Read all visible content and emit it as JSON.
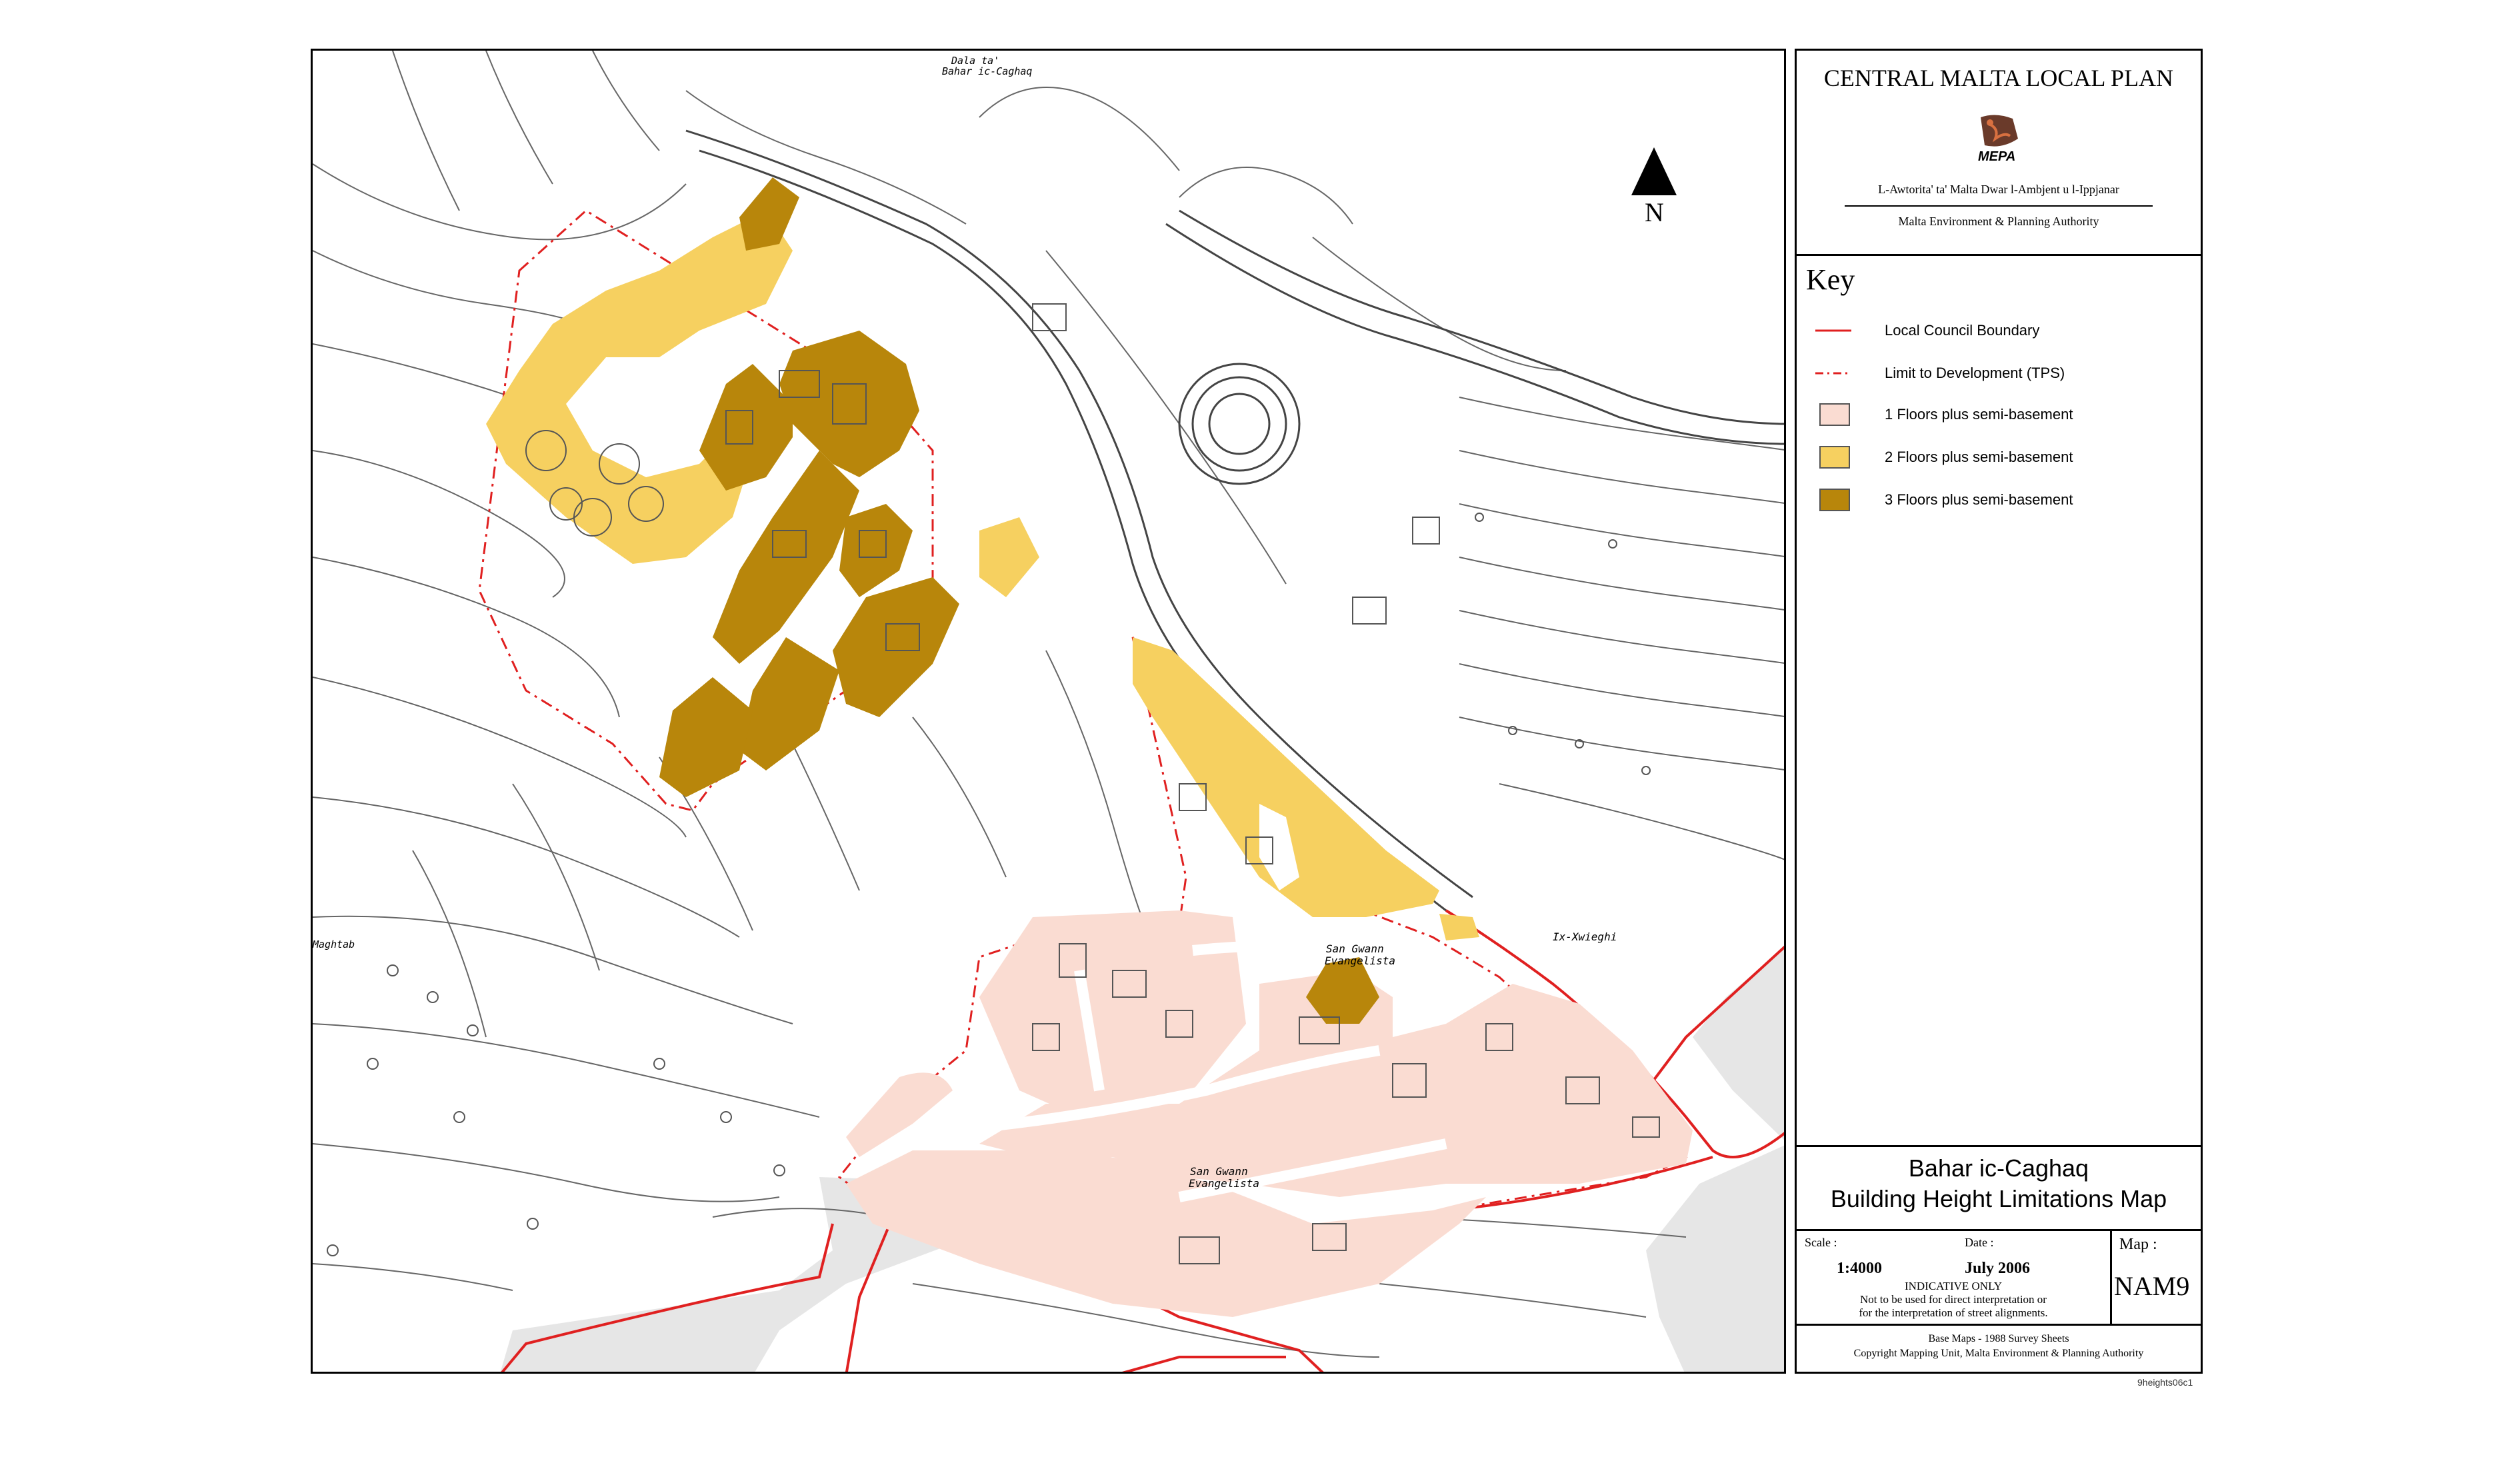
{
  "header": {
    "plan_title": "CENTRAL MALTA LOCAL PLAN",
    "logo_text": "MEPA",
    "authority_maltese": "L-Awtorita' ta' Malta Dwar l-Ambjent u l-Ippjanar",
    "authority_english": "Malta Environment & Planning Authority"
  },
  "north_arrow": {
    "label": "N"
  },
  "key": {
    "title": "Key",
    "items": [
      {
        "label": "Local Council Boundary",
        "style": "line",
        "color": "#e02020"
      },
      {
        "label": "Limit to Development (TPS)",
        "style": "dashdot",
        "color": "#e02020"
      },
      {
        "label": "1 Floors plus semi-basement",
        "style": "fill",
        "color": "#fadcd2"
      },
      {
        "label": "2 Floors plus semi-basement",
        "style": "fill",
        "color": "#f6d060"
      },
      {
        "label": "3 Floors plus semi-basement",
        "style": "fill",
        "color": "#b8860b"
      }
    ]
  },
  "map_title": {
    "line1": "Bahar ic-Caghaq",
    "line2": "Building Height Limitations Map"
  },
  "details": {
    "scale_label": "Scale :",
    "scale_value": "1:4000",
    "date_label": "Date :",
    "date_value": "July 2006",
    "indicative": "INDICATIVE ONLY",
    "note1": "Not to be used for direct interpretation or",
    "note2": "for the interpretation of street alignments.",
    "map_label": "Map :",
    "map_value": "NAM9"
  },
  "footer": {
    "base_maps": "Base Maps - 1988 Survey Sheets",
    "copyright": "Copyright Mapping Unit, Malta Environment & Planning Authority",
    "file_ref": "9heights06c1"
  },
  "place_labels": {
    "dala": "Dala ta'",
    "bahar": "Bahar ic-Caghaq",
    "maghtab": "Maghtab",
    "xwieghi": "Ix-Xwieghi",
    "san_gwann_1": "San Gwann",
    "evangelista_1": "Evangelista",
    "san_gwann_2": "San Gwann",
    "evangelista_2": "Evangelista"
  },
  "colors": {
    "floors_1": "#fadcd2",
    "floors_2": "#f6d060",
    "floors_3": "#b8860b",
    "boundary": "#e02020",
    "outside": "#e6e6e6"
  }
}
